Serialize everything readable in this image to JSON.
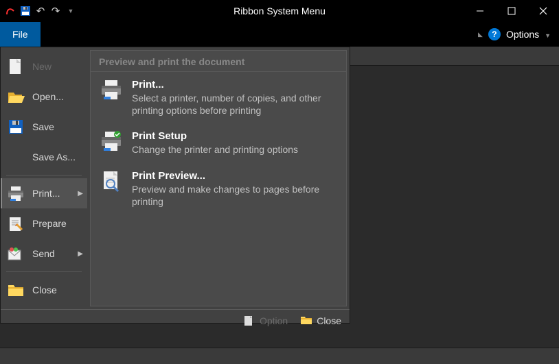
{
  "window": {
    "title": "Ribbon System Menu"
  },
  "ribbon": {
    "file_tab": "File",
    "options": "Options"
  },
  "backstage": {
    "left": {
      "new_label": "New",
      "open_label": "Open...",
      "save_label": "Save",
      "saveas_label": "Save As...",
      "print_label": "Print...",
      "prepare_label": "Prepare",
      "send_label": "Send",
      "close_label": "Close"
    },
    "right": {
      "panel_title": "Preview and print the document",
      "print": {
        "title": "Print...",
        "desc": "Select a printer, number of copies, and other printing options before printing"
      },
      "setup": {
        "title": "Print Setup",
        "desc": "Change the printer and printing options"
      },
      "preview": {
        "title": "Print Preview...",
        "desc": "Preview and make changes to pages before printing"
      }
    },
    "footer": {
      "option": "Option",
      "close": "Close"
    }
  }
}
